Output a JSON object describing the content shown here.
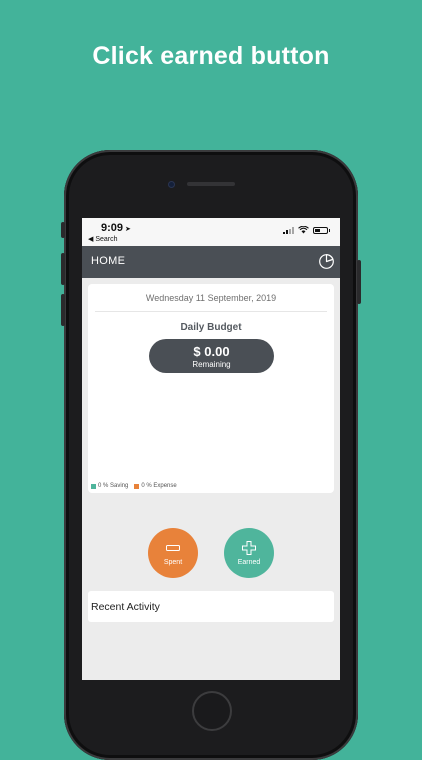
{
  "caption": "Click earned button",
  "status_bar": {
    "time": "9:09",
    "back_label": "◀ Search"
  },
  "header": {
    "title": "HOME",
    "icon": "pie-chart-icon"
  },
  "budget": {
    "date": "Wednesday 11 September, 2019",
    "title": "Daily Budget",
    "amount": "$ 0.00",
    "amount_label": "Remaining"
  },
  "legend": [
    {
      "label": "0 % Saving",
      "color": "#4fb59c"
    },
    {
      "label": "0 % Expense",
      "color": "#e8823a"
    }
  ],
  "actions": {
    "spent_label": "Spent",
    "earned_label": "Earned",
    "spent_color": "#e8823a",
    "earned_color": "#4fb59c"
  },
  "recent": {
    "title": "Recent Activity"
  },
  "colors": {
    "background": "#43b39a",
    "header": "#4a4f55"
  }
}
